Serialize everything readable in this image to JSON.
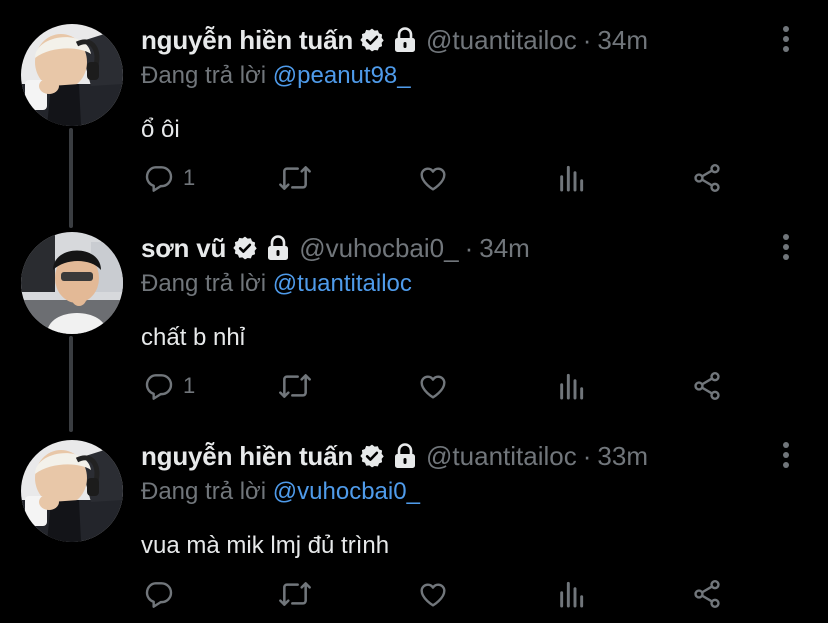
{
  "colors": {
    "background": "#000000",
    "text": "#e7e9ea",
    "muted": "#71767b",
    "link": "#4f9bea",
    "thread_line": "#3a3d41"
  },
  "tweets": [
    {
      "name": "nguyễn hiền tuấn",
      "handle": "@tuantitailoc",
      "separator": "·",
      "time": "34m",
      "reply_prefix": "Đang trả lời",
      "reply_to": "@peanut98_",
      "text": "ổ ôi",
      "reply_count": "1",
      "icons": [
        "verified-badge-icon",
        "lock-icon",
        "more-icon",
        "reply-icon",
        "retweet-icon",
        "like-icon",
        "views-icon",
        "share-icon"
      ]
    },
    {
      "name": "sơn vũ",
      "handle": "@vuhocbai0_",
      "separator": "·",
      "time": "34m",
      "reply_prefix": "Đang trả lời",
      "reply_to": "@tuantitailoc",
      "text": "chất b nhỉ",
      "reply_count": "1",
      "icons": [
        "verified-badge-icon",
        "lock-icon",
        "more-icon",
        "reply-icon",
        "retweet-icon",
        "like-icon",
        "views-icon",
        "share-icon"
      ]
    },
    {
      "name": "nguyễn hiền tuấn",
      "handle": "@tuantitailoc",
      "separator": "·",
      "time": "33m",
      "reply_prefix": "Đang trả lời",
      "reply_to": "@vuhocbai0_",
      "text": "vua mà mik lmj đủ trình",
      "reply_count": "",
      "icons": [
        "verified-badge-icon",
        "lock-icon",
        "more-icon",
        "reply-icon",
        "retweet-icon",
        "like-icon",
        "views-icon",
        "share-icon"
      ]
    }
  ]
}
